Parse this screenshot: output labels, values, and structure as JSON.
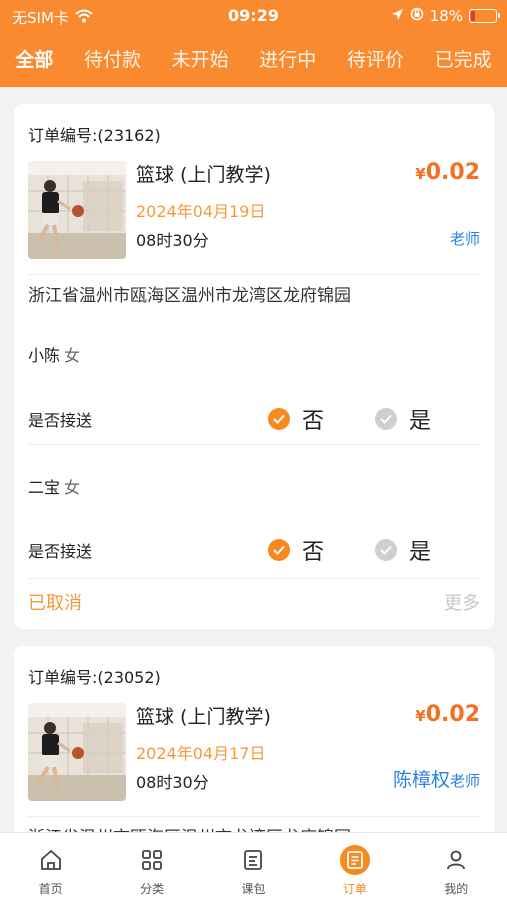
{
  "status_bar": {
    "carrier": "无SIM卡",
    "time": "09:29",
    "battery": "18%",
    "battery_level": 0.18,
    "icons": [
      "wifi-icon",
      "location-icon",
      "orientation-lock-icon",
      "battery-charging-icon"
    ]
  },
  "tabs": [
    {
      "label": "全部",
      "active": true
    },
    {
      "label": "待付款"
    },
    {
      "label": "未开始"
    },
    {
      "label": "进行中"
    },
    {
      "label": "待评价"
    },
    {
      "label": "已完成"
    }
  ],
  "orders": [
    {
      "order_no": "订单编号:(23162)",
      "course": "篮球 (上门教学)",
      "price_symbol": "¥",
      "price": "0.02",
      "date": "2024年04月19日",
      "time": "08时30分",
      "teacher_name": "",
      "teacher_role": "老师",
      "address": "浙江省温州市瓯海区温州市龙湾区龙府锦园",
      "students": [
        {
          "name": "小陈",
          "gender": "女",
          "pickup_label": "是否接送",
          "no_label": "否",
          "yes_label": "是",
          "selected": "no"
        },
        {
          "name": "二宝",
          "gender": "女",
          "pickup_label": "是否接送",
          "no_label": "否",
          "yes_label": "是",
          "selected": "no"
        }
      ],
      "status": "已取消",
      "more": "更多"
    },
    {
      "order_no": "订单编号:(23052)",
      "course": "篮球 (上门教学)",
      "price_symbol": "¥",
      "price": "0.02",
      "date": "2024年04月17日",
      "time": "08时30分",
      "teacher_name": "陈樟权",
      "teacher_role": "老师",
      "address": "浙江省温州市瓯海区温州市龙湾区龙府锦园"
    }
  ],
  "bottom_nav": [
    {
      "label": "首页",
      "icon": "home-icon"
    },
    {
      "label": "分类",
      "icon": "grid-icon"
    },
    {
      "label": "课包",
      "icon": "package-icon"
    },
    {
      "label": "订单",
      "icon": "order-icon",
      "active": true
    },
    {
      "label": "我的",
      "icon": "user-icon"
    }
  ],
  "colors": {
    "accent": "#fa8a2f",
    "price": "#f37021",
    "teacher": "#2a82e4",
    "date": "#f39a3c"
  }
}
